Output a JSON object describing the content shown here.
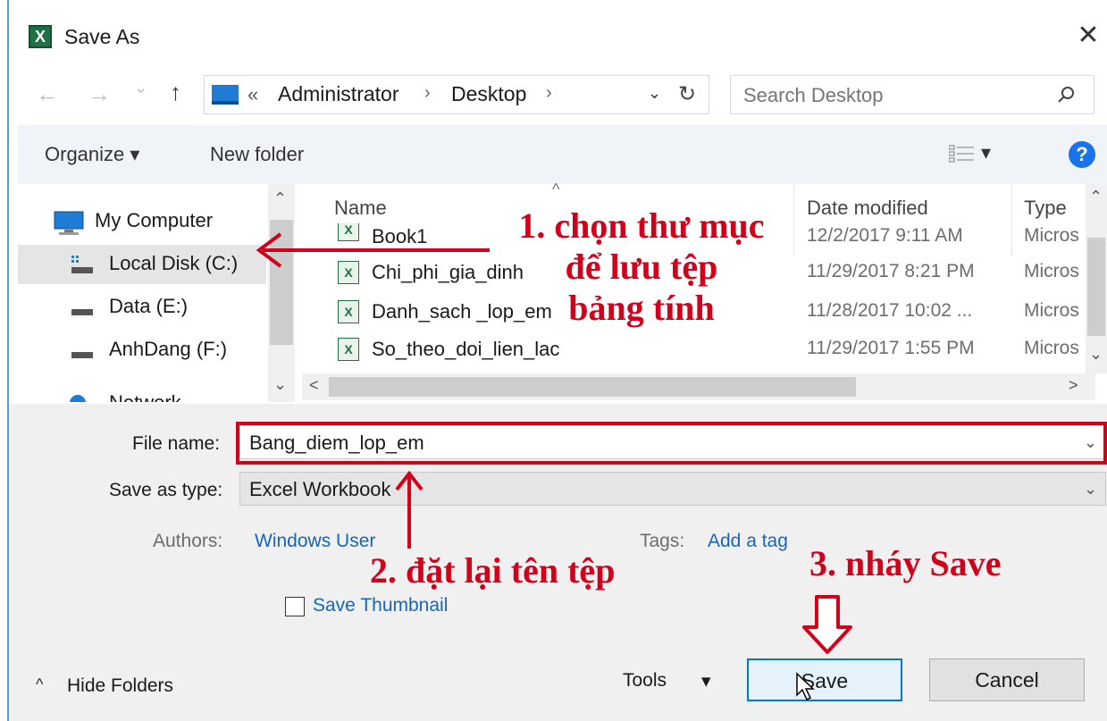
{
  "window": {
    "title": "Save As",
    "close_glyph": "✕",
    "app_icon_letter": "X"
  },
  "nav": {
    "back_glyph": "←",
    "forward_glyph": "→",
    "recent_glyph": "⌄",
    "up_glyph": "↑",
    "address": {
      "overflow": "«",
      "segments": [
        "Administrator",
        "Desktop"
      ],
      "separator": "›",
      "dropdown_glyph": "⌄",
      "refresh_glyph": "↻"
    },
    "search_placeholder": "Search Desktop"
  },
  "toolbar": {
    "organize_label": "Organize ▾",
    "new_folder_label": "New folder",
    "view_dropdown_glyph": "▾",
    "help_glyph": "?"
  },
  "sidebar": {
    "items": [
      {
        "label": "My Computer",
        "icon": "computer-icon",
        "selected": false
      },
      {
        "label": "Local Disk (C:)",
        "icon": "drive-icon",
        "selected": true
      },
      {
        "label": "Data (E:)",
        "icon": "drive-icon",
        "selected": false
      },
      {
        "label": "AnhDang (F:)",
        "icon": "drive-icon",
        "selected": false
      },
      {
        "label": "Network",
        "icon": "network-icon",
        "selected": false
      }
    ],
    "scroll_up_glyph": "⌃",
    "scroll_down_glyph": "⌄"
  },
  "filelist": {
    "columns": {
      "name": "Name",
      "date": "Date modified",
      "type": "Type"
    },
    "sort_glyph": "^",
    "files": [
      {
        "name": "Book1",
        "date": "12/2/2017 9:11 AM",
        "type": "Micros"
      },
      {
        "name": "Chi_phi_gia_dinh",
        "date": "11/29/2017 8:21 PM",
        "type": "Micros"
      },
      {
        "name": "Danh_sach _lop_em",
        "date": "11/28/2017 10:02 ...",
        "type": "Micros"
      },
      {
        "name": "So_theo_doi_lien_lac",
        "date": "11/29/2017 1:55 PM",
        "type": "Micros"
      }
    ],
    "hscroll_left_glyph": "<",
    "hscroll_right_glyph": ">",
    "vscroll_up_glyph": "⌃",
    "vscroll_down_glyph": "⌄"
  },
  "form": {
    "file_name_label": "File name:",
    "file_name_value": "Bang_diem_lop_em",
    "save_as_type_label": "Save as type:",
    "save_as_type_value": "Excel Workbook",
    "authors_label": "Authors:",
    "authors_value": "Windows User",
    "tags_label": "Tags:",
    "tags_value": "Add a tag",
    "thumbnail_label": "Save Thumbnail",
    "dropdown_glyph": "⌄"
  },
  "footer": {
    "hide_folders_label": "Hide Folders",
    "hide_folders_glyph": "^",
    "tools_label": "Tools",
    "tools_glyph": "▾",
    "save_label": "Save",
    "cancel_label": "Cancel"
  },
  "annotations": {
    "step1_lines": [
      "1. chọn thư mục",
      "để lưu tệp",
      "bảng tính"
    ],
    "step2": "2. đặt lại tên tệp",
    "step3": "3. nháy Save",
    "color": "#d0021b"
  }
}
